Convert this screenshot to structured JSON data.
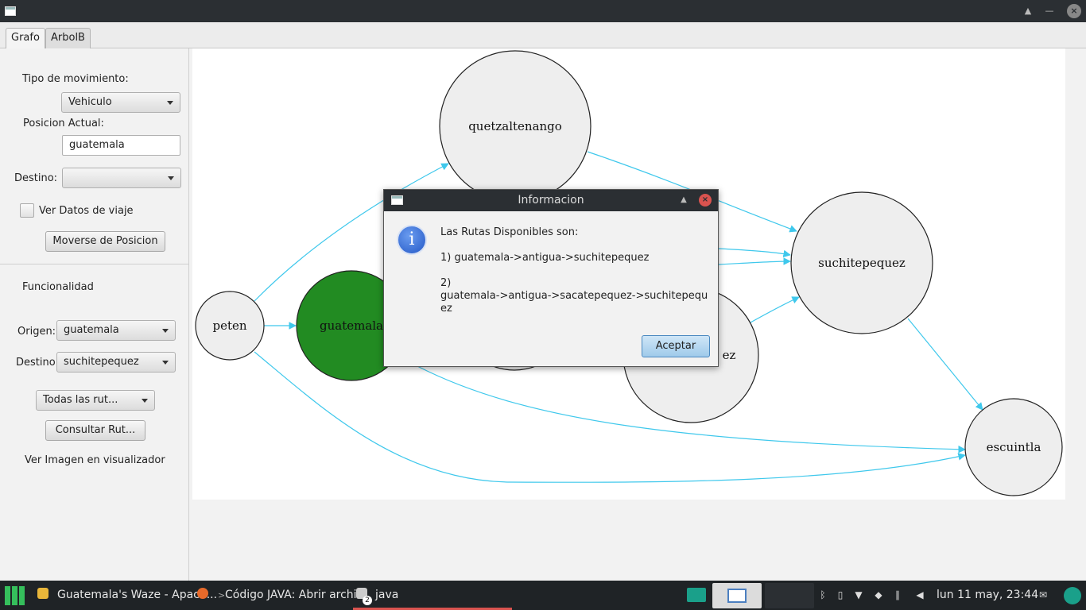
{
  "window": {
    "title": ""
  },
  "tabs": [
    {
      "label": "Grafo",
      "active": true
    },
    {
      "label": "ArbolB",
      "active": false
    }
  ],
  "left_panel": {
    "tipo_movimiento_label": "Tipo de movimiento:",
    "tipo_movimiento_value": "Vehiculo",
    "posicion_actual_label": "Posicion Actual:",
    "posicion_actual_value": "guatemala",
    "destino_label": "Destino:",
    "destino_value": "",
    "ver_datos_label": "Ver Datos de viaje",
    "ver_datos_checked": false,
    "moverse_button": "Moverse de Posicion",
    "funcionalidad_label": "Funcionalidad",
    "origen_label": "Origen:",
    "origen_value": "guatemala",
    "destino2_label": "Destino",
    "destino2_value": "suchitepequez",
    "todas_rutas_value": "Todas las rut...",
    "consultar_button": "Consultar Rut...",
    "ver_imagen_label": "Ver Imagen en visualizador"
  },
  "graph": {
    "nodes": [
      {
        "id": "quetzaltenango",
        "label": "quetzaltenango",
        "fill": "#eeeeee"
      },
      {
        "id": "suchitepequez",
        "label": "suchitepequez",
        "fill": "#eeeeee"
      },
      {
        "id": "peten",
        "label": "peten",
        "fill": "#eeeeee"
      },
      {
        "id": "guatemala",
        "label": "guatemala",
        "fill": "#228b22"
      },
      {
        "id": "sacatepequez",
        "label": "ez",
        "fill": "#eeeeee"
      },
      {
        "id": "escuintla",
        "label": "escuintla",
        "fill": "#eeeeee"
      }
    ],
    "edge_color": "#3fc8ec"
  },
  "dialog": {
    "title": "Informacion",
    "line1": "Las Rutas Disponibles son:",
    "line2": "1) guatemala->antigua->suchitepequez",
    "line3": "2)",
    "line4": "guatemala->antigua->sacatepequez->suchitepequ",
    "line5": "ez",
    "ok_button": "Aceptar",
    "icon": "info-icon"
  },
  "taskbar": {
    "item1": "Guatemala's Waze - Apach...",
    "item2": "Código JAVA: Abrir archi...",
    "item3": "java",
    "item3_badge": "2",
    "clock": "lun 11 may, 23:44"
  },
  "colors": {
    "titlebar": "#2b2f33",
    "taskbar": "#1f2326",
    "accent": "#4b89c0",
    "guatemala_node": "#228b22",
    "edge": "#3fc8ec"
  }
}
